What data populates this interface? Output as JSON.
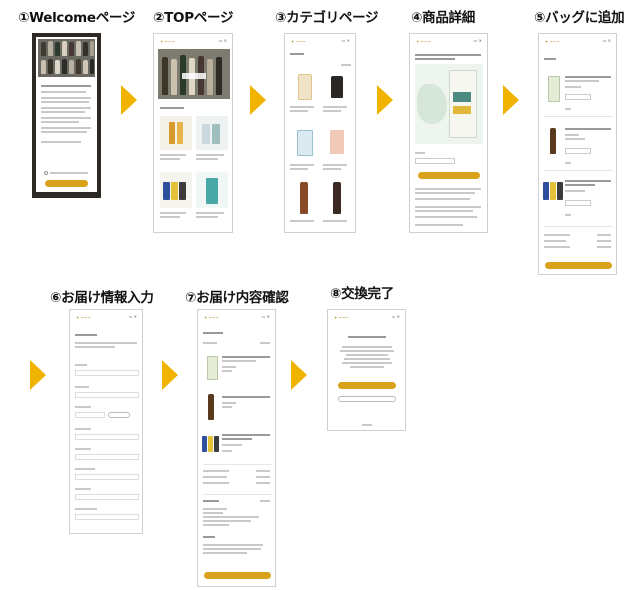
{
  "steps": [
    {
      "label": "①Welcomeページ"
    },
    {
      "label": "②TOPページ"
    },
    {
      "label": "③カテゴリページ"
    },
    {
      "label": "④商品詳細"
    },
    {
      "label": "⑤バッグに追加"
    },
    {
      "label": "⑥お届け情報入力"
    },
    {
      "label": "⑦お届け内容確認"
    },
    {
      "label": "⑧交換完了"
    }
  ],
  "colors": {
    "accent": "#d9a21b",
    "arrow": "#f0b400",
    "border": "#cfcfcf"
  }
}
